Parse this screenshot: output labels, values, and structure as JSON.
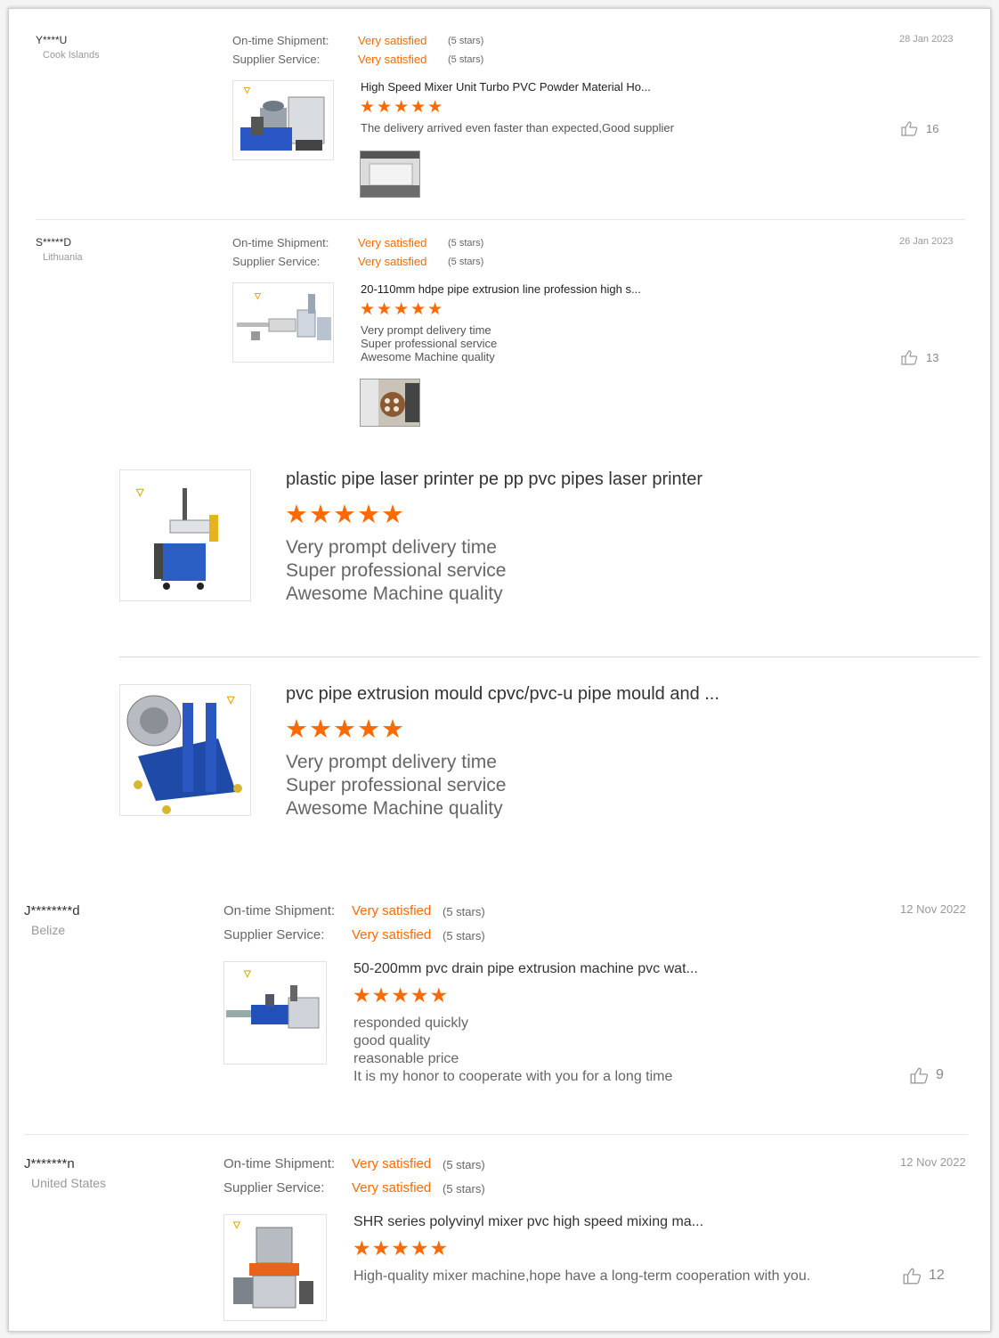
{
  "labels": {
    "shipment": "On-time Shipment:",
    "service": "Supplier Service:",
    "satisfied": "Very satisfied",
    "five_stars": "(5 stars)",
    "stars_glyph": "★★★★★"
  },
  "reviews": [
    {
      "name": "Y****U",
      "country": "Cook Islands",
      "date": "28 Jan 2023",
      "product": "High Speed Mixer Unit Turbo PVC Powder Material Ho...",
      "lines": [
        "The delivery arrived even faster than expected,Good supplier"
      ],
      "likes": "16",
      "product_image_icon": "mixer-machine-image",
      "photo_icon": "customer-photo"
    },
    {
      "name": "S*****D",
      "country": "Lithuania",
      "date": "26 Jan 2023",
      "product": "20-110mm hdpe pipe extrusion line profession high s...",
      "lines": [
        "Very prompt delivery time",
        "Super professional service",
        "Awesome Machine quality"
      ],
      "likes": "13",
      "product_image_icon": "extrusion-line-image",
      "photo_icon": "customer-photo"
    }
  ],
  "sub_reviews": [
    {
      "product": "plastic pipe laser printer pe pp pvc pipes laser printer",
      "lines": [
        "Very prompt delivery time",
        "Super professional service",
        "Awesome Machine quality"
      ],
      "product_image_icon": "laser-printer-image"
    },
    {
      "product": "pvc pipe extrusion mould cpvc/pvc-u pipe mould and ...",
      "lines": [
        "Very prompt delivery time",
        "Super professional service",
        "Awesome Machine quality"
      ],
      "product_image_icon": "pipe-mould-image"
    }
  ],
  "reviews2": [
    {
      "name": "J********d",
      "country": "Belize",
      "date": "12 Nov 2022",
      "product": "50-200mm pvc drain pipe extrusion machine pvc wat...",
      "lines": [
        "responded quickly",
        "good quality",
        "reasonable price",
        "It is my honor to cooperate with you for a long time"
      ],
      "likes": "9",
      "product_image_icon": "extrusion-machine-image"
    },
    {
      "name": "J*******n",
      "country": "United States",
      "date": "12 Nov 2022",
      "product": "SHR series polyvinyl mixer pvc high speed mixing ma...",
      "lines": [
        "High-quality mixer machine,hope have a long-term cooperation with you."
      ],
      "likes": "12",
      "product_image_icon": "mixer-machine-image"
    }
  ],
  "colors": {
    "accent": "#ff6a00",
    "muted": "#999999",
    "machine_blue": "#1f4aa8"
  }
}
